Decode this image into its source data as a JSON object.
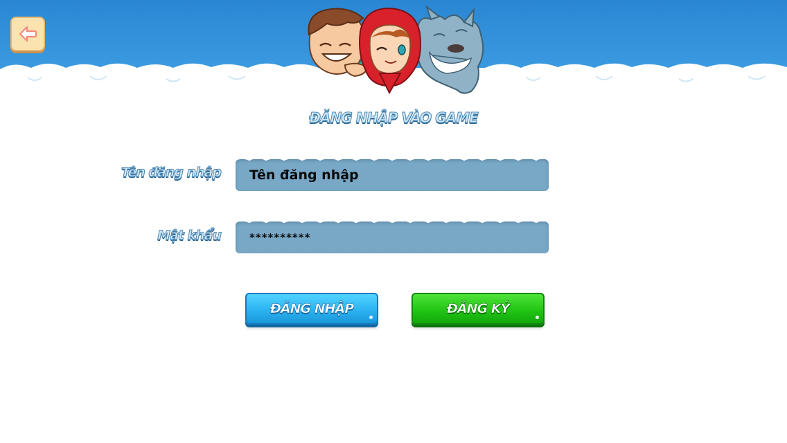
{
  "title": "ĐĂNG NHẬP VÀO GAME",
  "form": {
    "username_label": "Tên đăng nhập",
    "username_value": "Tên đăng nhập",
    "password_label": "Mật khẩu",
    "password_value": "**********"
  },
  "buttons": {
    "login_label": "ĐĂNG NHẬP",
    "register_label": "ĐĂNG KÝ"
  },
  "icons": {
    "back": "back-arrow-icon",
    "mascots": "mascot-characters"
  },
  "colors": {
    "sky": "#2f8fd8",
    "login_button": "#2cb3f2",
    "register_button": "#22c515",
    "field_fill": "#79a8c6",
    "label_fill": "#cfe8f7",
    "label_outline": "#4a86b2"
  }
}
